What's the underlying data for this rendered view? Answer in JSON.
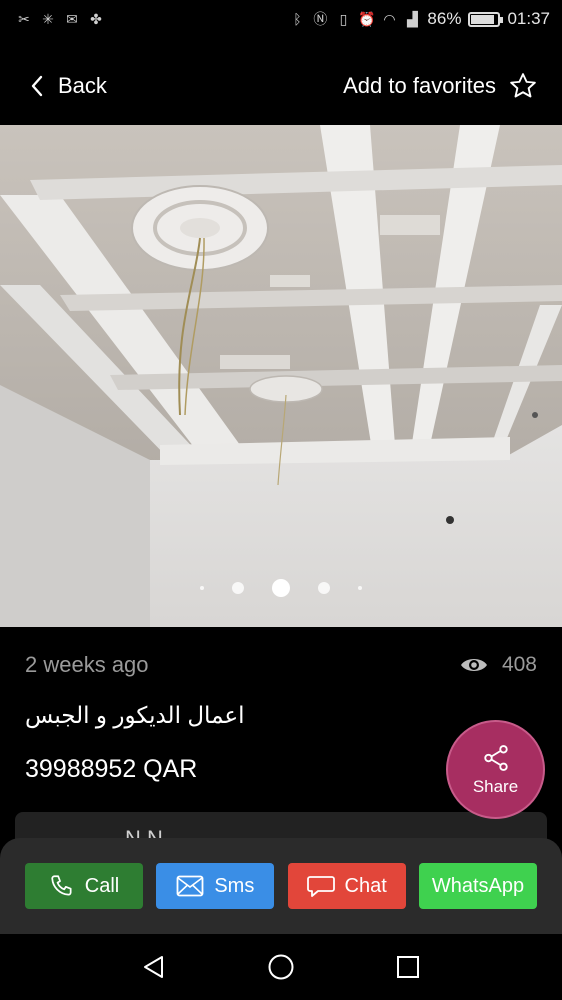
{
  "status_bar": {
    "battery_percent": "86%",
    "time": "01:37"
  },
  "header": {
    "back_label": "Back",
    "favorites_label": "Add to favorites"
  },
  "gallery": {
    "current_index": 2,
    "total_dots": 5
  },
  "listing": {
    "posted_time": "2 weeks ago",
    "views": "408",
    "title": "اعمال الديكور و الجبس",
    "price": "39988952 QAR",
    "card_peek": "N  N"
  },
  "share": {
    "label": "Share"
  },
  "actions": {
    "call_label": "Call",
    "sms_label": "Sms",
    "chat_label": "Chat",
    "whatsapp_label": "WhatsApp"
  },
  "colors": {
    "call": "#2e7d32",
    "sms": "#3a8ee6",
    "chat": "#e2463a",
    "whatsapp": "#3fd14f",
    "share": "#a72e61"
  }
}
